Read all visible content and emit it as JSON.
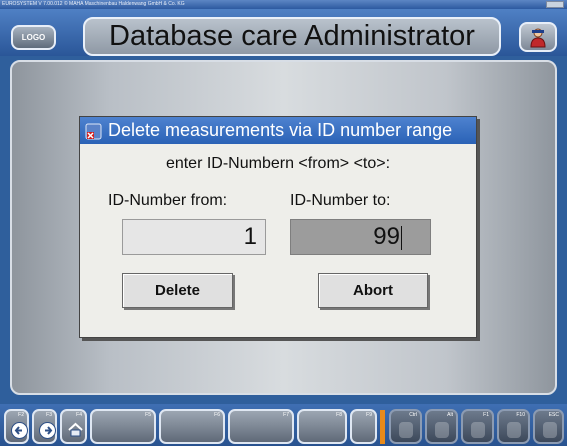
{
  "window": {
    "caption": "EUROSYSTEM V 7.00.012 © MAHA Maschinenbau Haldenwang GmbH & Co. KG"
  },
  "header": {
    "logo_label": "LOGO",
    "title": "Database care Administrator",
    "help_icon": "help-person-icon"
  },
  "dialog": {
    "title": "Delete measurements via ID number range",
    "prompt": "enter ID-Numbern <from> <to>:",
    "from_label": "ID-Number from:",
    "to_label": "ID-Number to:",
    "from_value": "1",
    "to_value": "99",
    "delete_label": "Delete",
    "abort_label": "Abort"
  },
  "footer": {
    "keys": [
      {
        "key": "F2",
        "icon": "arrow-left-icon"
      },
      {
        "key": "F3",
        "icon": "arrow-right-icon"
      },
      {
        "key": "F4",
        "icon": "home-icon"
      },
      {
        "key": "F5",
        "icon": ""
      },
      {
        "key": "F6",
        "icon": ""
      },
      {
        "key": "F7",
        "icon": ""
      },
      {
        "key": "F8",
        "icon": ""
      },
      {
        "key": "F9",
        "icon": ""
      },
      {
        "key": "Ctrl",
        "icon": "ghost-icon"
      },
      {
        "key": "Alt",
        "icon": "ghost-icon"
      },
      {
        "key": "F1",
        "icon": "ghost-icon"
      },
      {
        "key": "F10",
        "icon": "ghost-icon"
      },
      {
        "key": "ESC",
        "icon": "ghost-icon"
      }
    ]
  },
  "colors": {
    "background": "#2f5f9c",
    "dialog_title": "#2a62b6",
    "accent_orange": "#e88a1a"
  }
}
